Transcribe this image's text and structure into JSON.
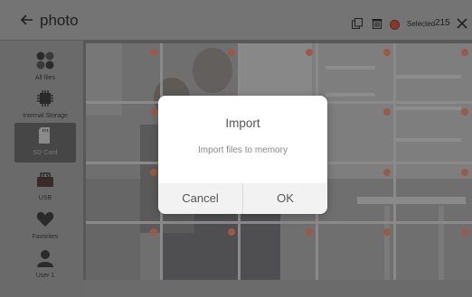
{
  "titlebar": {
    "title": "photo",
    "selected_label": "Selected",
    "selected_count": "215",
    "icons": [
      "back-icon",
      "copy-icon",
      "trash-icon",
      "record-icon",
      "close-icon"
    ]
  },
  "sidebar": {
    "items": [
      {
        "label": "All files",
        "icon": "grid-icon",
        "active": false
      },
      {
        "label": "Internal Storage",
        "icon": "chip-icon",
        "active": false
      },
      {
        "label": "SD Card",
        "icon": "sd-card-icon",
        "active": true
      },
      {
        "label": "USB",
        "icon": "usb-icon",
        "active": false
      },
      {
        "label": "Favorites",
        "icon": "heart-icon",
        "active": false
      },
      {
        "label": "User 1",
        "icon": "user-icon",
        "active": false
      }
    ]
  },
  "dialog": {
    "title": "Import",
    "message": "Import files to memory",
    "cancel_label": "Cancel",
    "ok_label": "OK"
  },
  "colors": {
    "overlay": "#585858",
    "dialog_bg": "#ffffff",
    "dialog_actions_bg": "#f2f2f2",
    "selection_badge": "#c0563a"
  }
}
